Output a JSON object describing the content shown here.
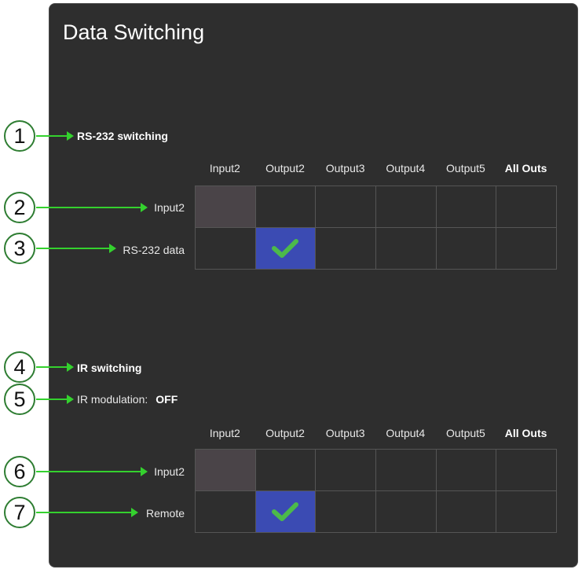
{
  "title": "Data Switching",
  "rs232": {
    "section_title": "RS-232 switching",
    "columns": [
      "Input2",
      "Output2",
      "Output3",
      "Output4",
      "Output5",
      "All Outs"
    ],
    "rows": [
      "Input2",
      "RS-232 data"
    ]
  },
  "ir": {
    "section_title": "IR switching",
    "modulation_label": "IR modulation:",
    "modulation_value": "OFF",
    "columns": [
      "Input2",
      "Output2",
      "Output3",
      "Output4",
      "Output5",
      "All Outs"
    ],
    "rows": [
      "Input2",
      "Remote"
    ]
  },
  "callouts": [
    "1",
    "2",
    "3",
    "4",
    "5",
    "6",
    "7"
  ],
  "colors": {
    "active_cell": "#3b4bb3",
    "check": "#4cba4a",
    "arrow": "#34d12e"
  }
}
